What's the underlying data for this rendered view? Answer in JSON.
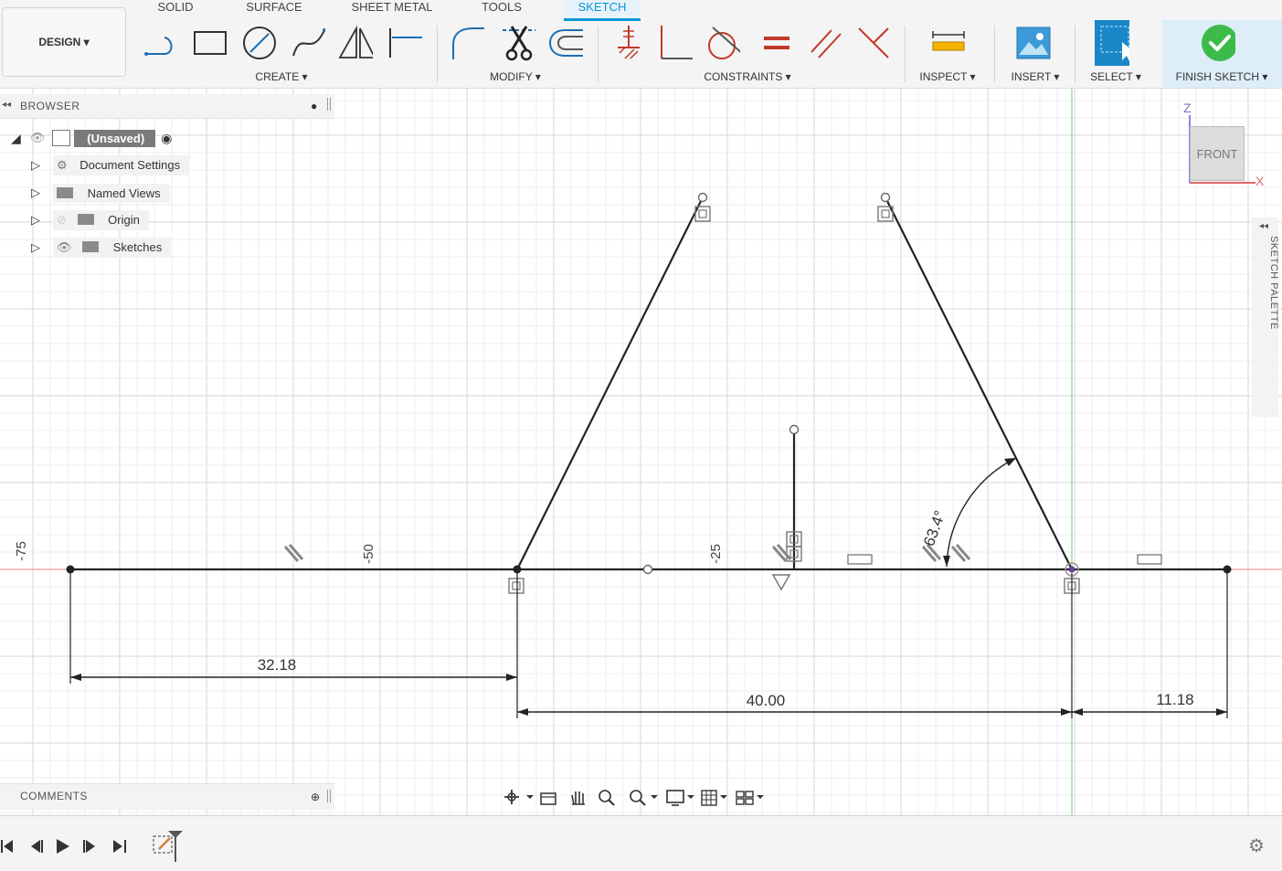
{
  "workspace": {
    "label": "DESIGN ▾"
  },
  "tabs": [
    {
      "label": "SOLID",
      "active": false
    },
    {
      "label": "SURFACE",
      "active": false
    },
    {
      "label": "SHEET METAL",
      "active": false
    },
    {
      "label": "TOOLS",
      "active": false
    },
    {
      "label": "SKETCH",
      "active": true
    }
  ],
  "toolbar_groups": {
    "create": "CREATE ▾",
    "modify": "MODIFY ▾",
    "constraints": "CONSTRAINTS ▾",
    "inspect": "INSPECT ▾",
    "insert": "INSERT ▾",
    "select": "SELECT ▾",
    "finish": "FINISH SKETCH ▾"
  },
  "browser": {
    "title": "BROWSER",
    "root": "(Unsaved)",
    "items": [
      {
        "label": "Document Settings",
        "icon": "gear-icon"
      },
      {
        "label": "Named Views",
        "icon": "folder-icon"
      },
      {
        "label": "Origin",
        "icon": "folder-icon"
      },
      {
        "label": "Sketches",
        "icon": "folder-icon"
      }
    ]
  },
  "comments": {
    "title": "COMMENTS"
  },
  "sketch_palette": {
    "label": "SKETCH PALETTE"
  },
  "viewcube": {
    "face": "FRONT",
    "axis_z": "Z",
    "axis_x": "X"
  },
  "sketch": {
    "axis_labels": [
      "-75",
      "-50",
      "-25"
    ],
    "dimensions": {
      "left_length": "32.18",
      "base_length": "40.00",
      "right_length": "11.18",
      "angle": "63.4°"
    }
  },
  "colors": {
    "accent": "#0696d7",
    "finish_green": "#3dbb4a",
    "constraint_red": "#c0392b",
    "axis_red": "#f08080",
    "axis_green": "#70d070"
  }
}
